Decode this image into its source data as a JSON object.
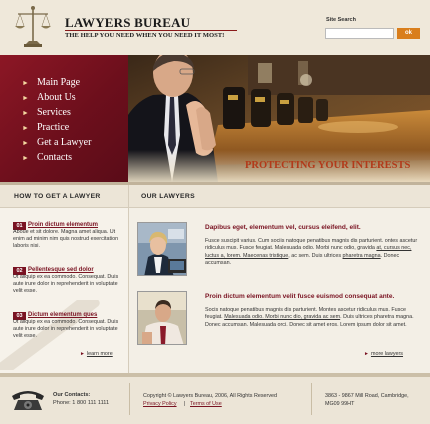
{
  "header": {
    "title": "LAWYERS BUREAU",
    "tagline": "THE HELP YOU NEED WHEN YOU NEED IT MOST!",
    "logo_icon": "scales-of-justice-icon",
    "search": {
      "label": "Site Search",
      "placeholder": "",
      "button": "ok"
    }
  },
  "nav": {
    "items": [
      {
        "label": "Main Page"
      },
      {
        "label": "About Us"
      },
      {
        "label": "Services"
      },
      {
        "label": "Practice"
      },
      {
        "label": "Get a Lawyer"
      },
      {
        "label": "Contacts"
      }
    ],
    "bullet": "►"
  },
  "banner": {
    "caption": "PROTECTING YOUR INTERESTS"
  },
  "sections": {
    "how": "HOW TO GET A LAWYER",
    "ours": "OUR LAWYERS"
  },
  "steps": [
    {
      "num": "01",
      "title": "Proin dictum elementum",
      "body": "Aboue et sit dolore. Magna amet aliqua. Ut enim ad minim nim quis nostrud exercitation laboris nisi."
    },
    {
      "num": "02",
      "title": "Pellentesque sed dolor",
      "body": "Ut aliquip ex ea commodo. Consequat. Duis aute irure dolor in reprehenderit in voluptate velit esse."
    },
    {
      "num": "03",
      "title": "Dictum elementum ques",
      "body": "Ut aliquip ex ea commodo. Consequat. Duis aute irure dolor in reprehenderit in voluptate velit esse."
    }
  ],
  "learn_more": "learn more",
  "lawyers": [
    {
      "title": "Dapibus eget, elementum vel, cursus eleifend, elit.",
      "body_a": "Fusce suscipit varius. Cum sociis natoque penatibus magnis dis parturient. ontes ascetur ridiculus mus. Fusce feugiat. Malesuada odio. Morbi nunc odio, gravida ",
      "body_link": "at, cursus nec, luctus a, lorem. Maecenas tristique",
      "body_b": ", ac sem. Duis ultrices ",
      "body_link2": "pharetra magna",
      "body_c": ". Donec accumsan."
    },
    {
      "title": "Proin dictum elementum velit fusce euismod consequat ante.",
      "body_a": "Socis natoque penatibus magnis dis parturient.  Montes ascetur ridiculus mus. Fusce feugiat. ",
      "body_link": "Malesuada odio. Morbi nunc dio, gravida ac sem",
      "body_b": ". Duis ultrices pharetra magna. Donec accumsan. Malesuada orci. Donec sit amet eros. Lorem ipsum dolor sit amet.",
      "body_link2": "",
      "body_c": ""
    }
  ],
  "more_lawyers": "more lawyers",
  "footer": {
    "contacts_label": "Our Contacts:",
    "phone": "Phone: 1 800 111 1111",
    "copyright": "Copyright © Lawyers Bureau, 2006, All Rights Reserved",
    "privacy": "Privacy Policy",
    "sep": "|",
    "terms": "Terms of Use",
    "address1": "3863 - 9867 Mill Road, Cambridge,",
    "address2": "MG09 99HT"
  },
  "colors": {
    "accent": "#7a1322",
    "search_button": "#d97e1c",
    "caption": "#b23a1a"
  }
}
